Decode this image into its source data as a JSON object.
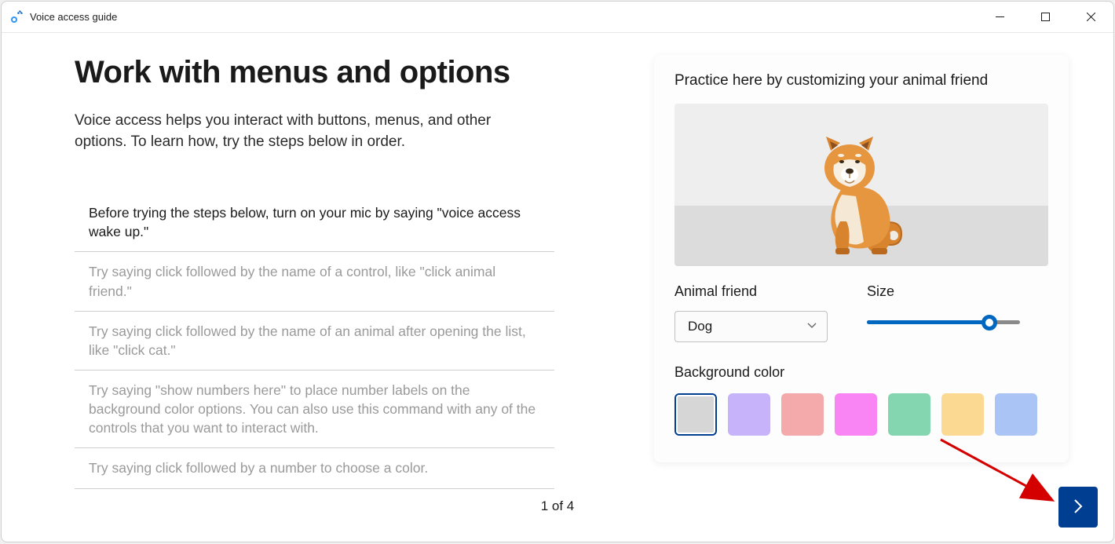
{
  "window": {
    "title": "Voice access guide"
  },
  "main": {
    "title": "Work with menus and options",
    "intro": "Voice access helps you interact with buttons, menus, and other options. To learn how, try the steps below in order.",
    "steps": [
      "Before trying the steps below, turn on your mic by saying \"voice access wake up.\"",
      "Try saying click followed by the name of a control, like \"click animal friend.\"",
      "Try saying click followed by the name of an animal after opening the list, like \"click cat.\"",
      "Try saying \"show numbers here\" to place number labels on the background color options. You can also use this command with any of the controls that you want to interact with.",
      "Try saying click followed by a number to choose a color."
    ]
  },
  "practice": {
    "title": "Practice here by customizing your animal friend",
    "animal_label": "Animal friend",
    "animal_value": "Dog",
    "size_label": "Size",
    "size_percent": 80,
    "bg_label": "Background color",
    "colors": [
      "#d6d6d6",
      "#c6b3fa",
      "#f4a9ab",
      "#f984f4",
      "#84d6b0",
      "#fbd993",
      "#a9c4f5"
    ],
    "selected_color_index": 0
  },
  "pager": {
    "text": "1 of 4",
    "current": 1,
    "total": 4
  }
}
